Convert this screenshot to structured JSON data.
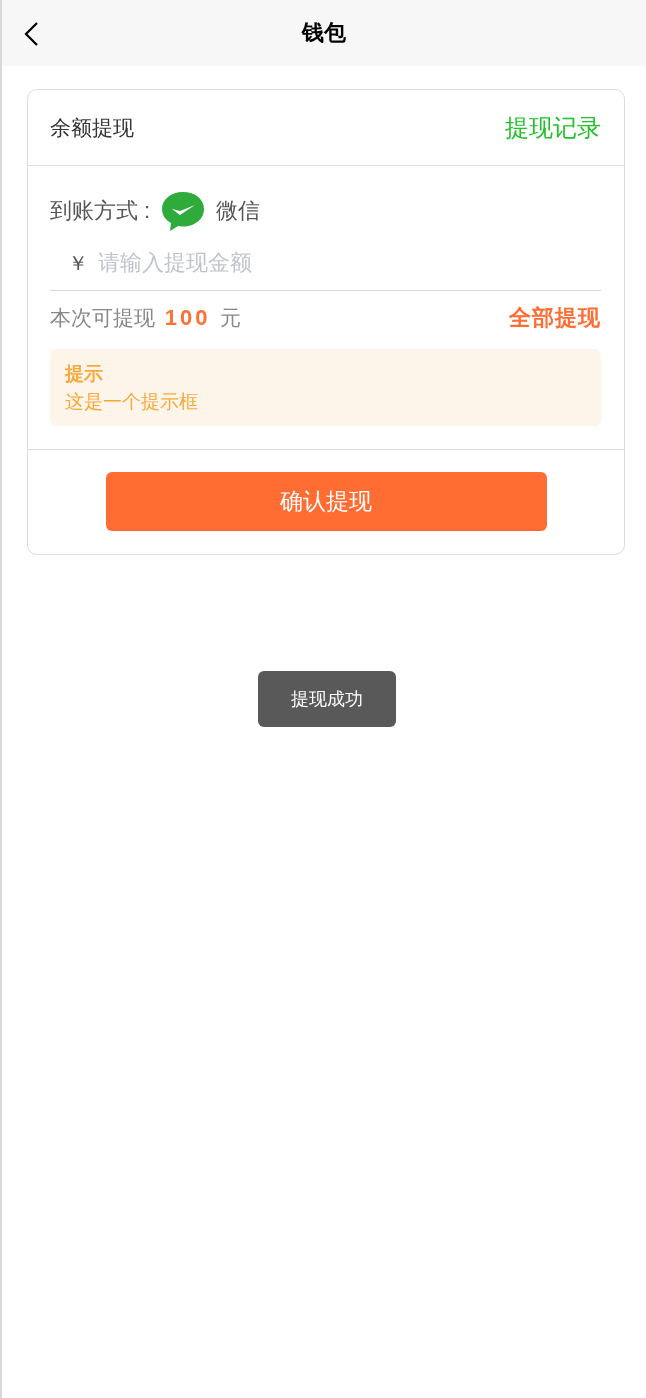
{
  "header": {
    "title": "钱包"
  },
  "card": {
    "title": "余额提现",
    "records_link": "提现记录",
    "method_label": "到账方式 :",
    "method_name": "微信",
    "currency_symbol": "￥",
    "amount_placeholder": "请输入提现金额",
    "available_prefix": "本次可提现",
    "available_amount": "100",
    "available_unit": "元",
    "withdraw_all": "全部提现",
    "tip": {
      "title": "提示",
      "message": "这是一个提示框"
    },
    "confirm_button": "确认提现"
  },
  "toast": "提现成功"
}
